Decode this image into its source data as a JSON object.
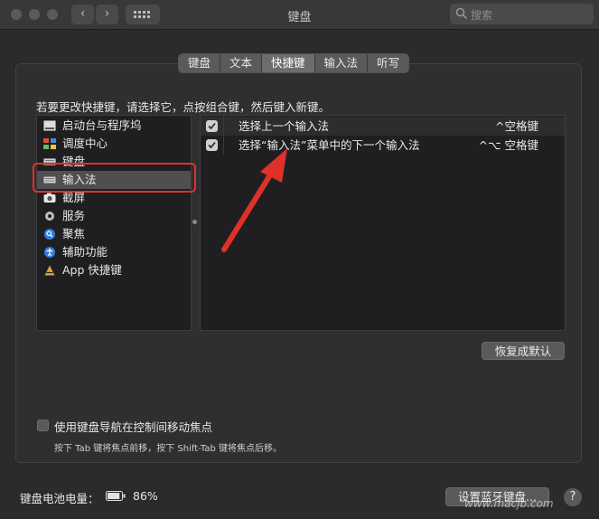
{
  "window": {
    "title": "键盘"
  },
  "toolbar": {
    "back": "‹",
    "forward": "›"
  },
  "search": {
    "placeholder": "搜索"
  },
  "tabs": [
    {
      "label": "键盘"
    },
    {
      "label": "文本"
    },
    {
      "label": "快捷键",
      "active": true
    },
    {
      "label": "输入法"
    },
    {
      "label": "听写"
    }
  ],
  "instruction": "若要更改快捷键，请选择它，点按组合键，然后键入新键。",
  "categories": [
    {
      "label": "启动台与程序坞",
      "icon": "launchpad-dock-icon"
    },
    {
      "label": "调度中心",
      "icon": "mission-control-icon"
    },
    {
      "label": "键盘",
      "icon": "keyboard-icon"
    },
    {
      "label": "输入法",
      "icon": "keyboard-icon",
      "selected": true
    },
    {
      "label": "截屏",
      "icon": "screenshot-icon"
    },
    {
      "label": "服务",
      "icon": "gear-icon"
    },
    {
      "label": "聚焦",
      "icon": "spotlight-icon"
    },
    {
      "label": "辅助功能",
      "icon": "accessibility-icon"
    },
    {
      "label": "App 快捷键",
      "icon": "app-store-icon"
    }
  ],
  "shortcuts": [
    {
      "checked": true,
      "label": "选择上一个输入法",
      "shortcut": "^空格键"
    },
    {
      "checked": true,
      "label": "选择“输入法”菜单中的下一个输入法",
      "shortcut": "^⌥ 空格键"
    }
  ],
  "restore_defaults": "恢复成默认",
  "keyboard_navigation": {
    "checked": false,
    "label": "使用键盘导航在控制间移动焦点",
    "hint": "按下 Tab 键将焦点前移，按下 Shift-Tab 键将焦点后移。"
  },
  "battery": {
    "label": "键盘电池电量：",
    "percent": "86%",
    "level": 0.86
  },
  "bluetooth_button": "设置蓝牙键盘...",
  "help": "?",
  "watermark": "www.macjb.com",
  "colors": {
    "highlight": "#e0302a",
    "arrow": "#e0302a"
  }
}
